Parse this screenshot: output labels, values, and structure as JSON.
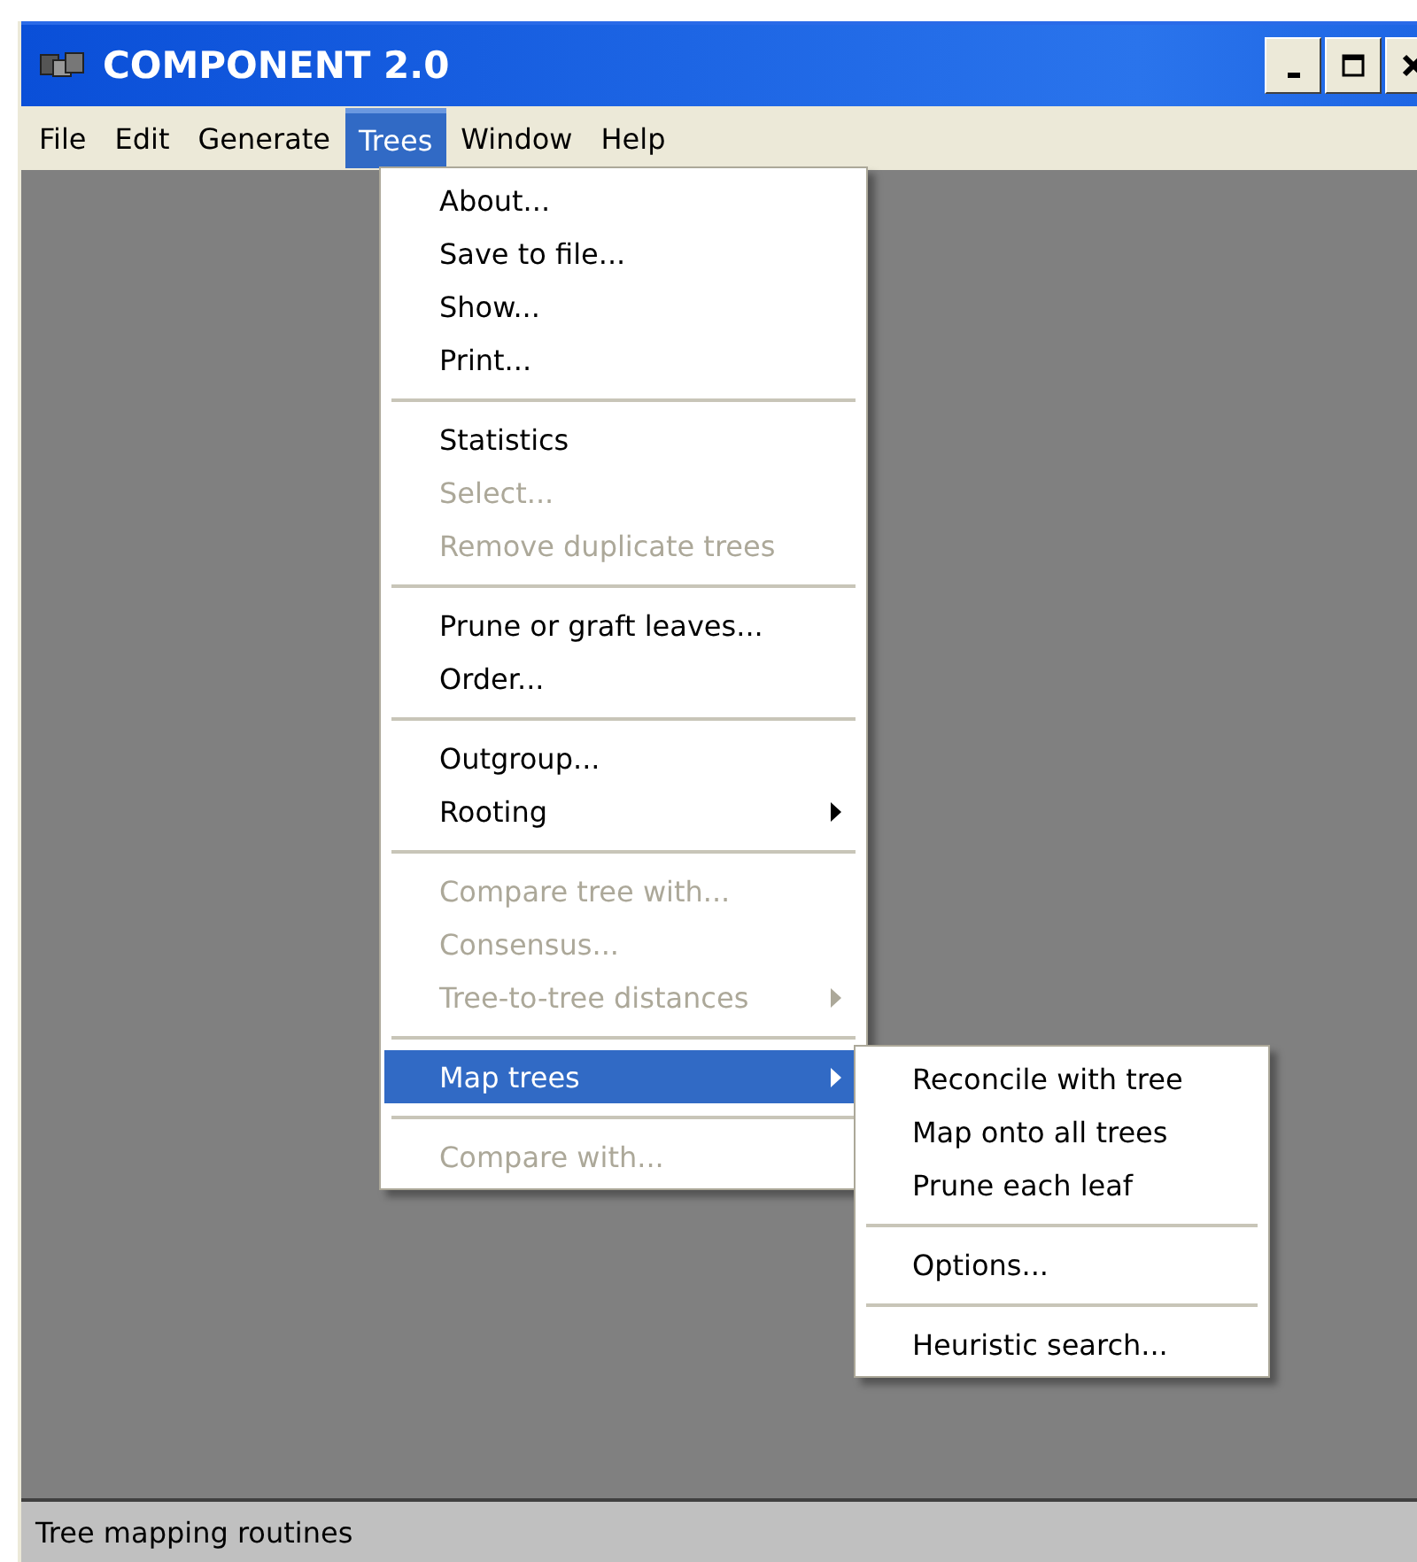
{
  "window": {
    "title": "COMPONENT 2.0"
  },
  "menu_bar": [
    {
      "label": "File",
      "selected": false
    },
    {
      "label": "Edit",
      "selected": false
    },
    {
      "label": "Generate",
      "selected": false
    },
    {
      "label": "Trees",
      "selected": true
    },
    {
      "label": "Window",
      "selected": false
    },
    {
      "label": "Help",
      "selected": false
    }
  ],
  "trees_menu": [
    {
      "kind": "item",
      "label": "About...",
      "disabled": false,
      "has_submenu": false,
      "selected": false
    },
    {
      "kind": "item",
      "label": "Save to file...",
      "disabled": false,
      "has_submenu": false,
      "selected": false
    },
    {
      "kind": "item",
      "label": "Show...",
      "disabled": false,
      "has_submenu": false,
      "selected": false
    },
    {
      "kind": "item",
      "label": "Print...",
      "disabled": false,
      "has_submenu": false,
      "selected": false
    },
    {
      "kind": "separator"
    },
    {
      "kind": "item",
      "label": "Statistics",
      "disabled": false,
      "has_submenu": false,
      "selected": false
    },
    {
      "kind": "item",
      "label": "Select...",
      "disabled": true,
      "has_submenu": false,
      "selected": false
    },
    {
      "kind": "item",
      "label": "Remove duplicate trees",
      "disabled": true,
      "has_submenu": false,
      "selected": false
    },
    {
      "kind": "separator"
    },
    {
      "kind": "item",
      "label": "Prune or graft leaves...",
      "disabled": false,
      "has_submenu": false,
      "selected": false
    },
    {
      "kind": "item",
      "label": "Order...",
      "disabled": false,
      "has_submenu": false,
      "selected": false
    },
    {
      "kind": "separator"
    },
    {
      "kind": "item",
      "label": "Outgroup...",
      "disabled": false,
      "has_submenu": false,
      "selected": false
    },
    {
      "kind": "item",
      "label": "Rooting",
      "disabled": false,
      "has_submenu": true,
      "selected": false
    },
    {
      "kind": "separator"
    },
    {
      "kind": "item",
      "label": "Compare tree with...",
      "disabled": true,
      "has_submenu": false,
      "selected": false
    },
    {
      "kind": "item",
      "label": "Consensus...",
      "disabled": true,
      "has_submenu": false,
      "selected": false
    },
    {
      "kind": "item",
      "label": "Tree-to-tree distances",
      "disabled": true,
      "has_submenu": true,
      "selected": false
    },
    {
      "kind": "separator"
    },
    {
      "kind": "item",
      "label": "Map trees",
      "disabled": false,
      "has_submenu": true,
      "selected": true
    },
    {
      "kind": "separator"
    },
    {
      "kind": "item",
      "label": "Compare with...",
      "disabled": true,
      "has_submenu": false,
      "selected": false
    }
  ],
  "map_trees_submenu": [
    {
      "kind": "item",
      "label": "Reconcile with tree",
      "disabled": false
    },
    {
      "kind": "item",
      "label": "Map onto all trees",
      "disabled": false
    },
    {
      "kind": "item",
      "label": "Prune each leaf",
      "disabled": false
    },
    {
      "kind": "separator"
    },
    {
      "kind": "item",
      "label": "Options...",
      "disabled": false
    },
    {
      "kind": "separator"
    },
    {
      "kind": "item",
      "label": "Heuristic search...",
      "disabled": false
    }
  ],
  "status_bar": "Tree mapping routines"
}
